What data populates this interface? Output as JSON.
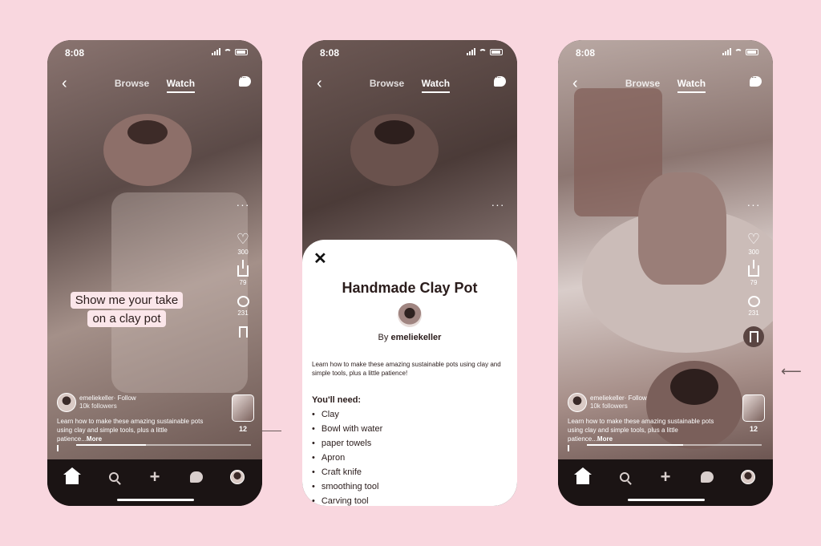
{
  "status": {
    "time": "8:08"
  },
  "nav": {
    "browse": "Browse",
    "watch": "Watch"
  },
  "phone1": {
    "caption_line1": "Show me your take",
    "caption_line2": "on a clay pot",
    "likes": "300",
    "shares": "79",
    "comments": "231",
    "thumb_count": "12",
    "creator_name": "emeliekeller· Follow",
    "followers": "10k followers",
    "description": "Learn how to make these amazing sustainable pots using clay and simple tools, plus a little patience...",
    "more": "More",
    "progress": 0.4
  },
  "phone2": {
    "sheet_title": "Handmade Clay Pot",
    "by_prefix": "By ",
    "author": "emeliekeller",
    "description": "Learn how to make these amazing sustainable pots using clay and simple tools, plus a little patience!",
    "need_heading": "You'll need:",
    "items": [
      "Clay",
      "Bowl with water",
      "paper towels",
      "Apron",
      "Craft knife",
      "smoothing tool",
      "Carving tool"
    ]
  },
  "phone3": {
    "likes": "300",
    "shares": "79",
    "comments": "231",
    "thumb_count": "12",
    "creator_name": "emeliekeller· Follow",
    "followers": "10k followers",
    "description": "Learn how to make these amazing sustainable pots using clay and simple tools, plus a little patience...",
    "more": "More",
    "progress": 0.55
  },
  "colors": {
    "background": "#f9d7df",
    "nav": "#1b1414",
    "caption_bg": "#fbe6ea"
  },
  "icons": [
    "back-arrow-icon",
    "chat-icon",
    "more-icon",
    "heart-icon",
    "share-icon",
    "comment-icon",
    "save-icon",
    "home-icon",
    "search-icon",
    "plus-icon",
    "messages-icon",
    "profile-icon",
    "close-icon",
    "pause-icon"
  ]
}
